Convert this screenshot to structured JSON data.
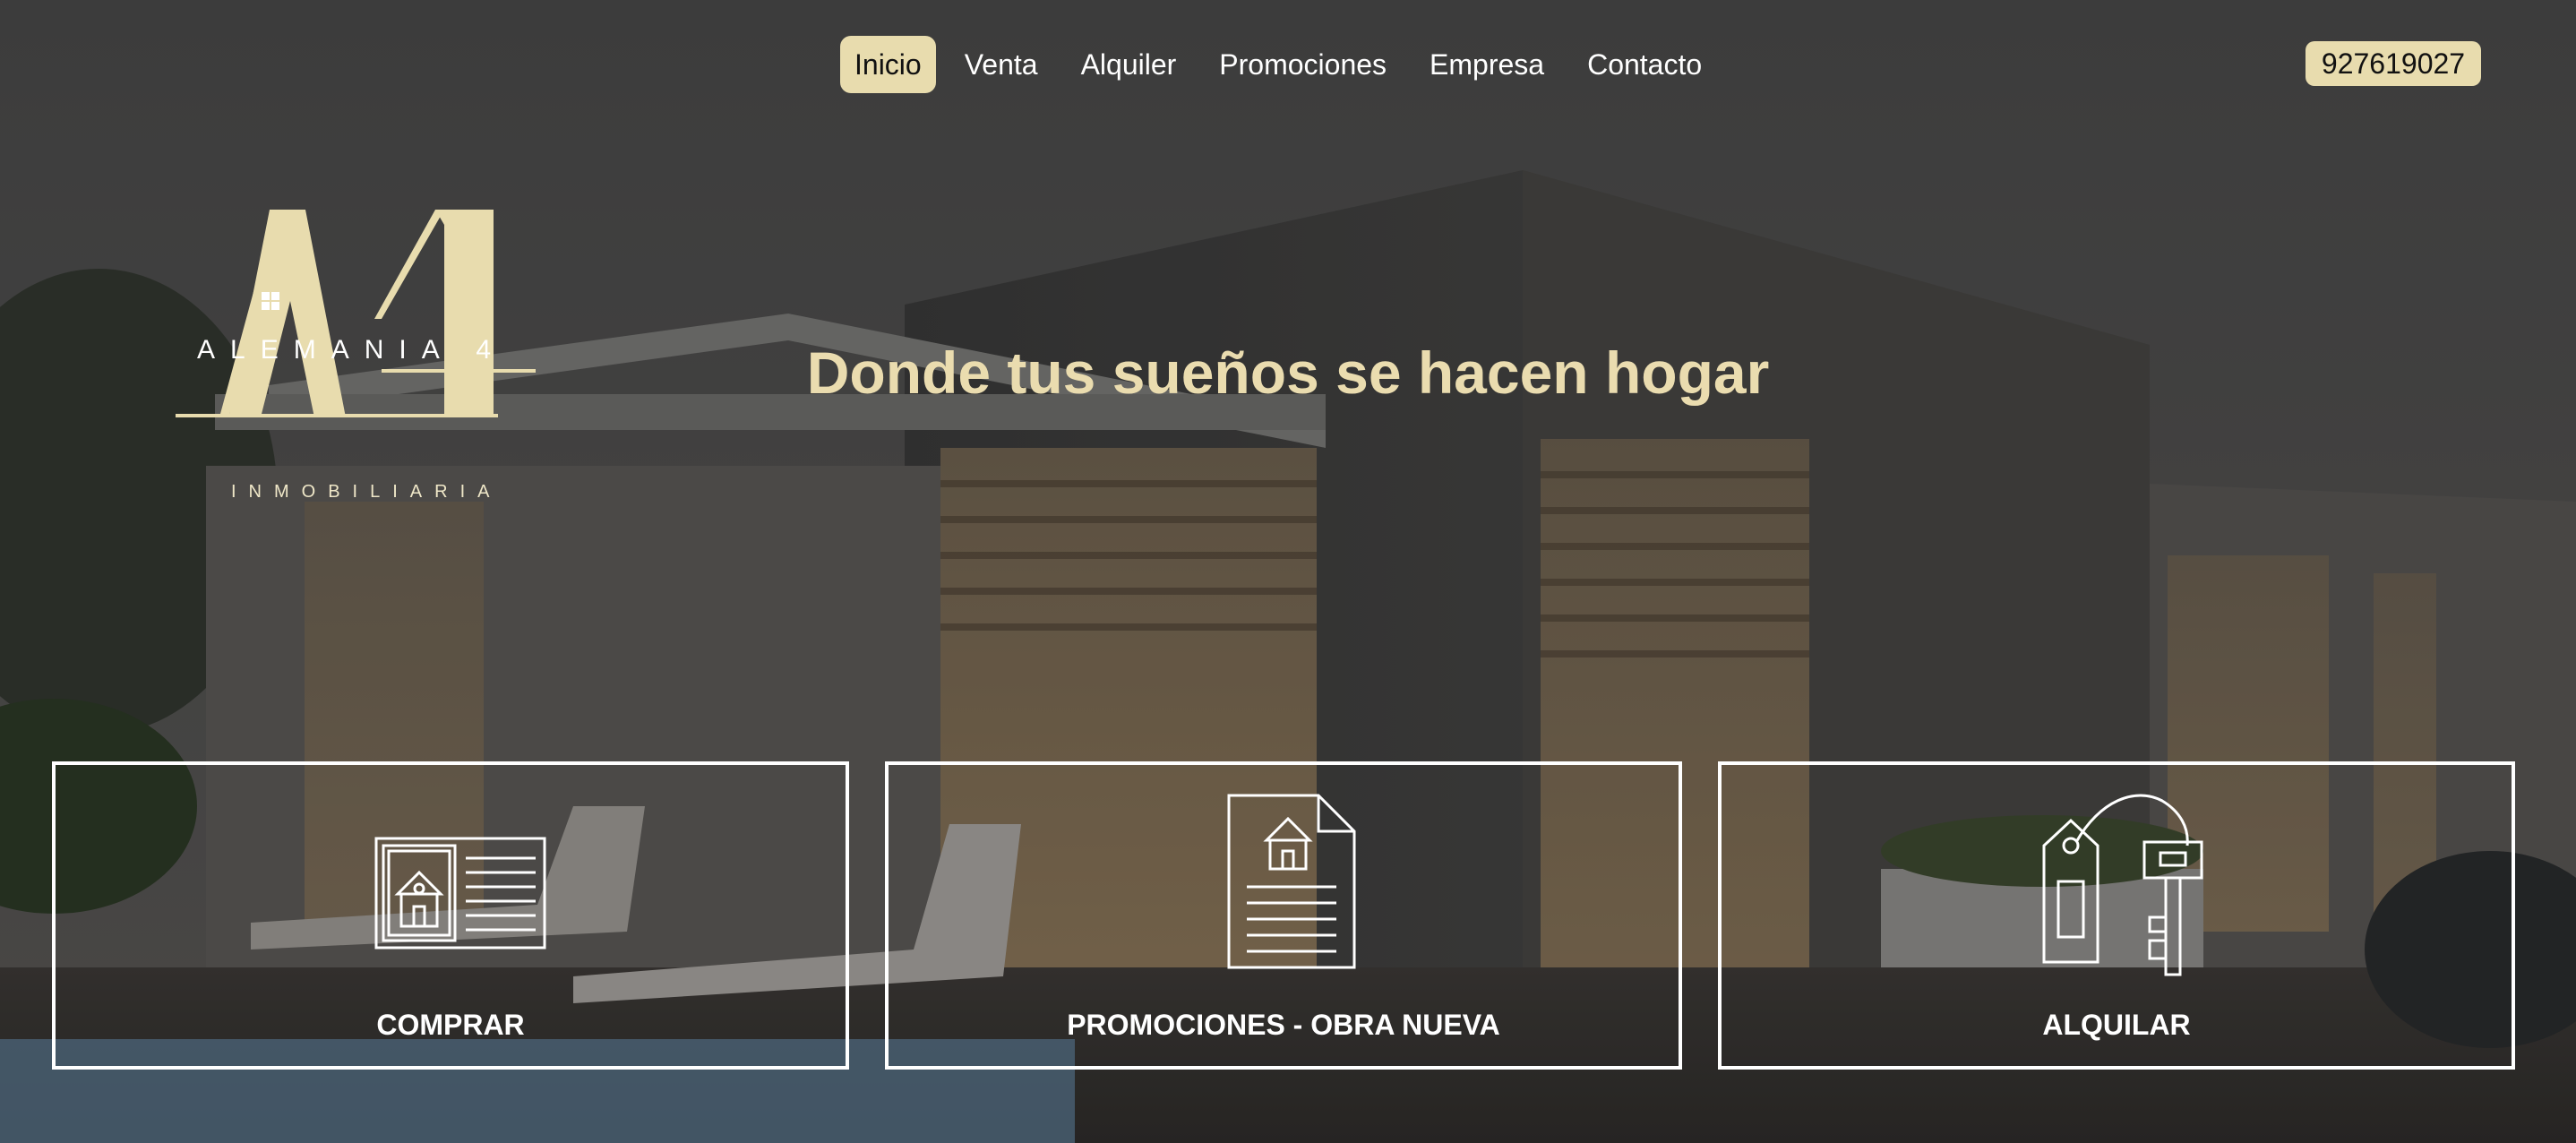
{
  "nav": {
    "items": [
      {
        "label": "Inicio",
        "active": true
      },
      {
        "label": "Venta",
        "active": false
      },
      {
        "label": "Alquiler",
        "active": false
      },
      {
        "label": "Promociones",
        "active": false
      },
      {
        "label": "Empresa",
        "active": false
      },
      {
        "label": "Contacto",
        "active": false
      }
    ],
    "phone": "927619027"
  },
  "logo": {
    "brand": "ALEMANIA 4",
    "subtitle": "INMOBILIARIA"
  },
  "hero": {
    "headline": "Donde tus sueños se hacen hogar"
  },
  "cards": [
    {
      "label": "COMPRAR",
      "icon": "house-listing-icon"
    },
    {
      "label": "PROMOCIONES - OBRA NUEVA",
      "icon": "document-house-icon"
    },
    {
      "label": "ALQUILAR",
      "icon": "house-key-tag-icon"
    }
  ],
  "colors": {
    "accent": "#e8dcae",
    "headline": "#eadcaf",
    "card_border": "#ffffff"
  }
}
